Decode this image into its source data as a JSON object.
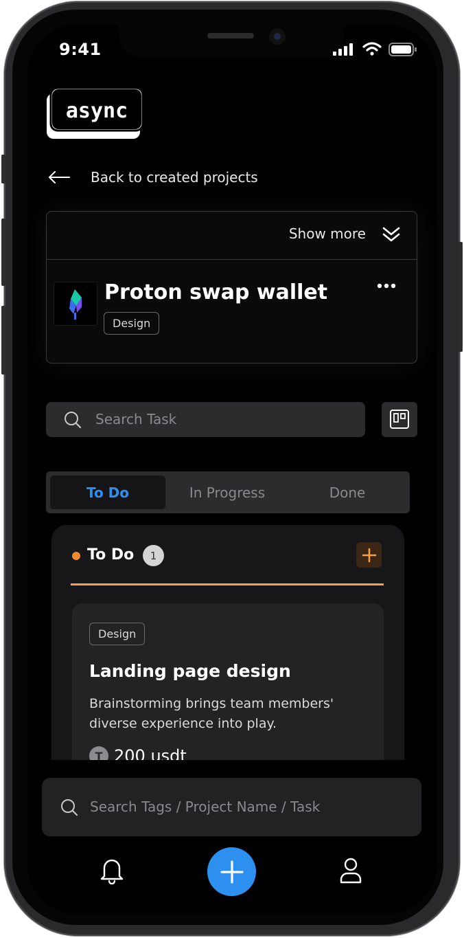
{
  "status_bar": {
    "time": "9:41"
  },
  "app": {
    "logo_text": "async"
  },
  "navigation": {
    "back_label": "Back to created projects"
  },
  "project": {
    "show_more_label": "Show more",
    "name": "Proton swap wallet",
    "tag": "Design"
  },
  "search_task": {
    "placeholder": "Search Task"
  },
  "tabs": [
    {
      "label": "To Do",
      "active": true
    },
    {
      "label": "In Progress",
      "active": false
    },
    {
      "label": "Done",
      "active": false
    }
  ],
  "column": {
    "title": "To Do",
    "count": "1",
    "accent_color": "#f08a2e"
  },
  "task": {
    "tag": "Design",
    "title": "Landing page design",
    "description": "Brainstorming brings team members' diverse experience into play.",
    "reward": "200 usdt",
    "token_letter": "T"
  },
  "bottom_search": {
    "placeholder": "Search Tags / Project Name / Task"
  },
  "bottom_nav": {
    "items": [
      "bell-icon",
      "plus-icon",
      "user-icon"
    ],
    "accent_color": "#2d8ff0"
  }
}
